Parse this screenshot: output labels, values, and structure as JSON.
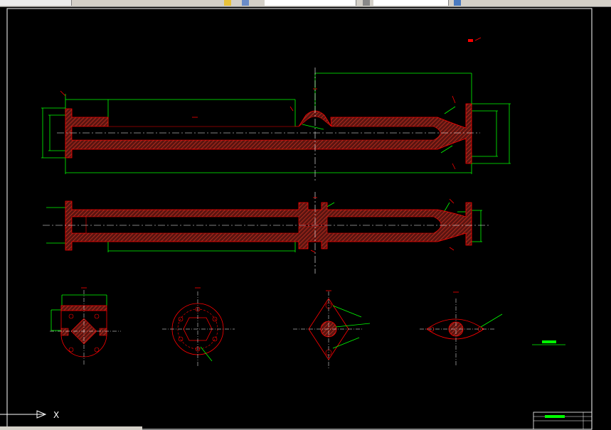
{
  "app": {
    "toolbar_icons": [
      "zoom-icon",
      "layer-icon",
      "properties-icon",
      "linetype-icon",
      "toolpalette-icon"
    ]
  },
  "ucs": {
    "x_label": "X"
  },
  "colors": {
    "background": "#000000",
    "dimension": "#00ff00",
    "outline": "#ff0000",
    "hatch": "#a0281e",
    "centerline": "#ffffff",
    "frame": "#ffffff"
  },
  "title_block": {
    "label": ""
  }
}
